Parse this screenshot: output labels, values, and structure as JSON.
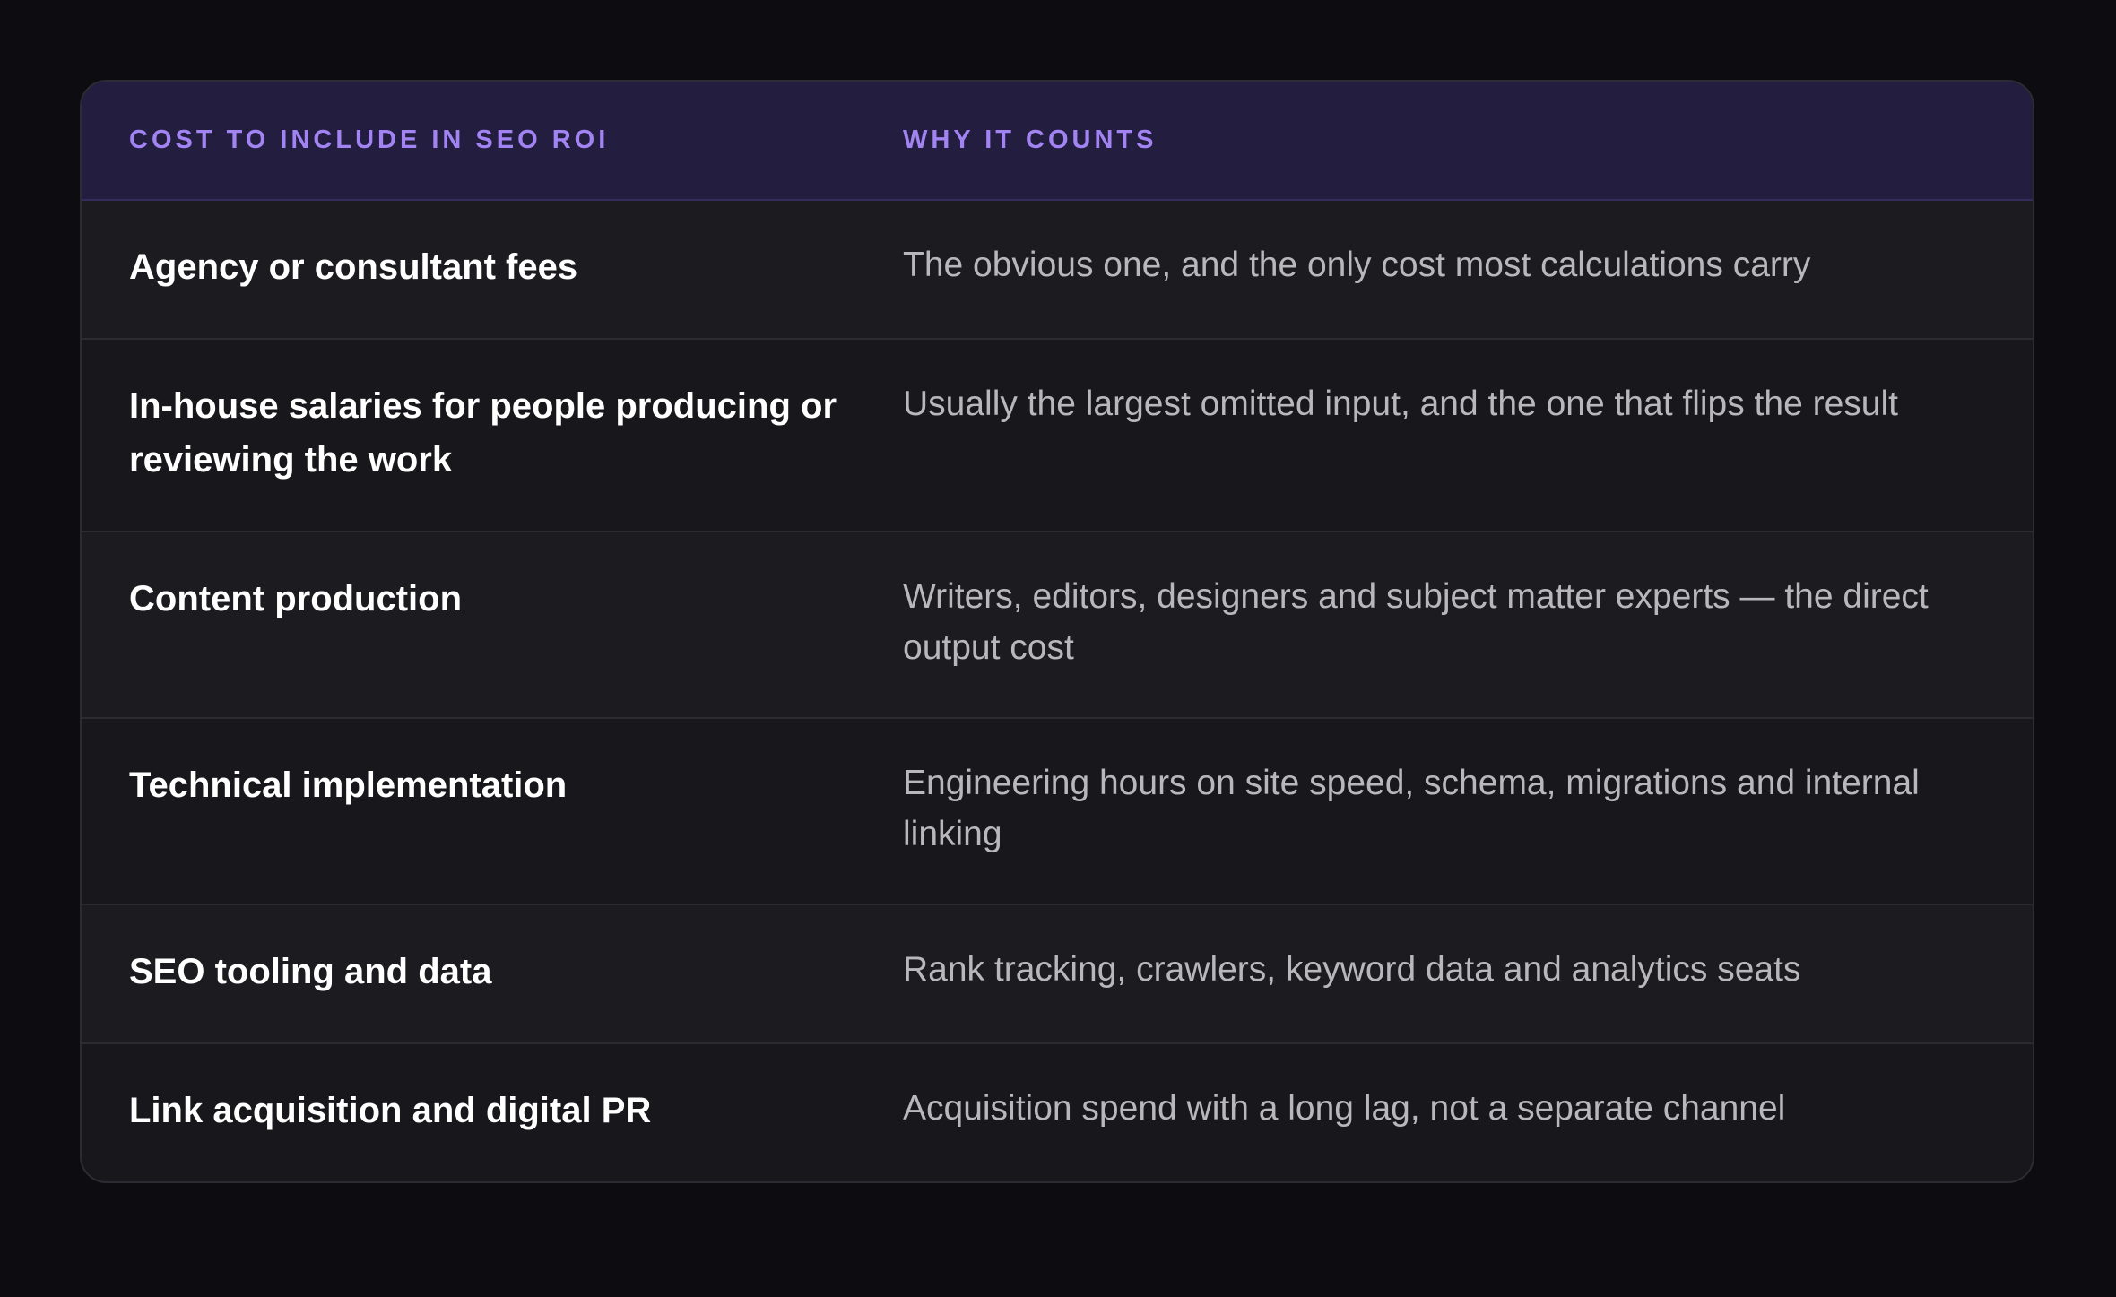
{
  "table": {
    "headers": {
      "cost": "Cost to include in SEO ROI",
      "why": "Why it counts"
    },
    "rows": [
      {
        "cost": "Agency or consultant fees",
        "why": "The obvious one, and the only cost most calculations carry"
      },
      {
        "cost": "In-house salaries for people producing or reviewing the work",
        "why": "Usually the largest omitted input, and the one that flips the result"
      },
      {
        "cost": "Content production",
        "why": "Writers, editors, designers and subject matter experts — the direct output cost"
      },
      {
        "cost": "Technical implementation",
        "why": "Engineering hours on site speed, schema, migrations and internal linking"
      },
      {
        "cost": "SEO tooling and data",
        "why": "Rank tracking, crawlers, keyword data and analytics seats"
      },
      {
        "cost": "Link acquisition and digital PR",
        "why": "Acquisition spend with a long lag, not a separate channel"
      }
    ]
  }
}
